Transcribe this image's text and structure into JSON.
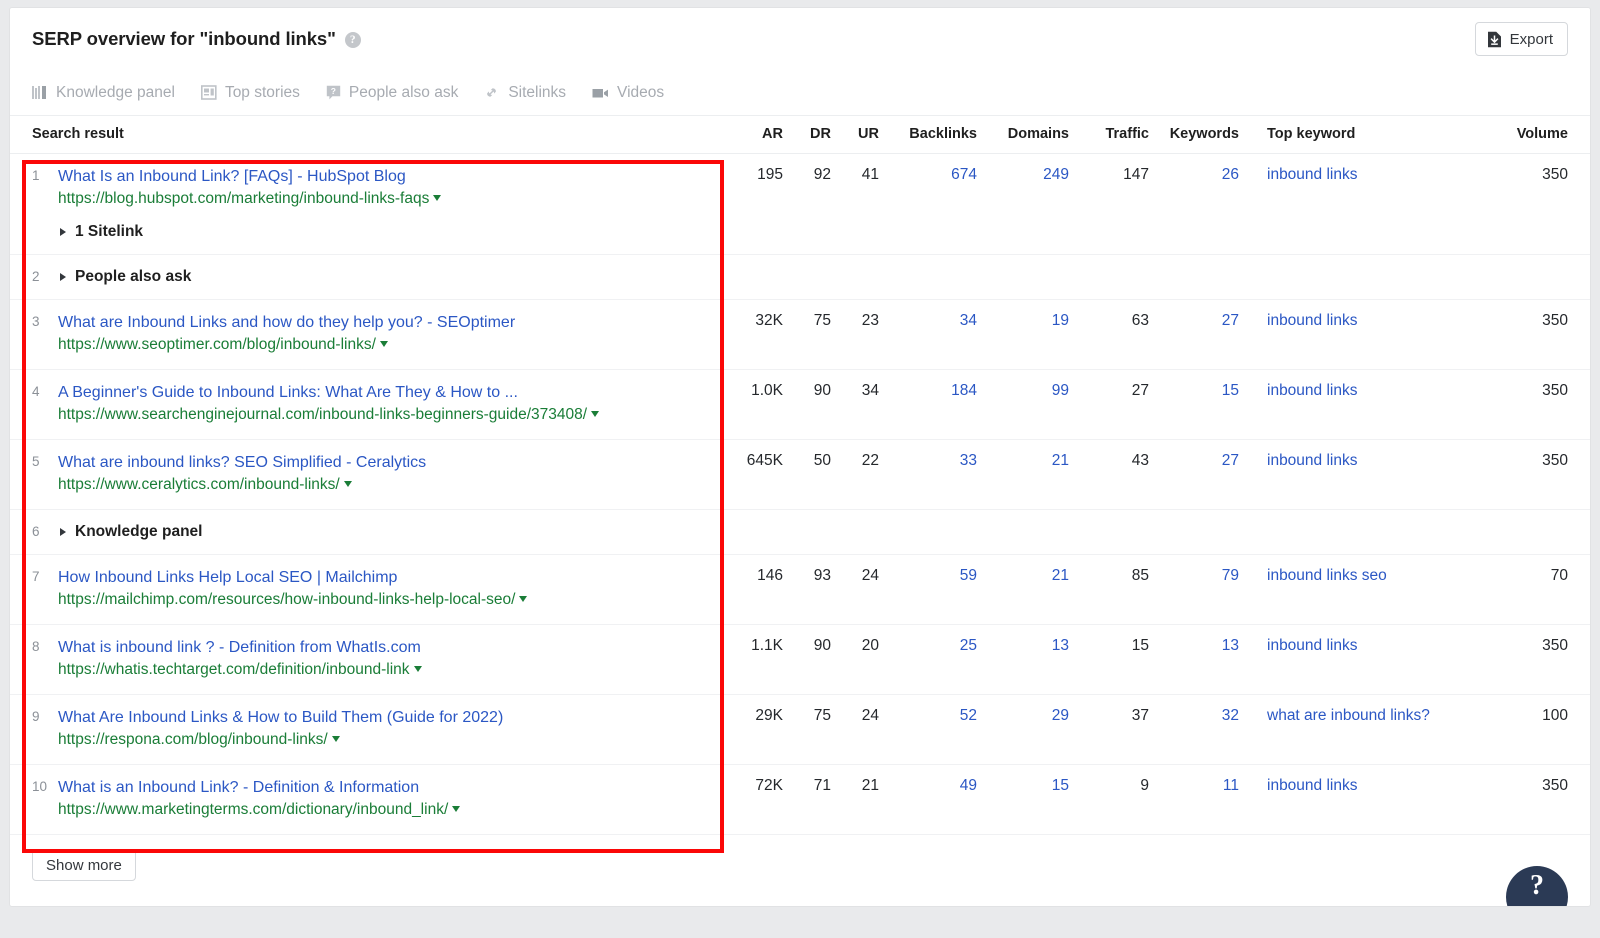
{
  "header": {
    "title": "SERP overview for \"inbound links\"",
    "help_icon": "help-circle-icon",
    "export_label": "Export",
    "export_icon": "file-download-icon"
  },
  "serp_features": [
    {
      "label": "Knowledge panel",
      "icon": "knowledge-panel-icon"
    },
    {
      "label": "Top stories",
      "icon": "top-stories-icon"
    },
    {
      "label": "People also ask",
      "icon": "people-also-ask-icon"
    },
    {
      "label": "Sitelinks",
      "icon": "sitelinks-chain-icon"
    },
    {
      "label": "Videos",
      "icon": "video-camera-icon"
    }
  ],
  "table": {
    "columns": [
      "Search result",
      "AR",
      "DR",
      "UR",
      "Backlinks",
      "Domains",
      "Traffic",
      "Keywords",
      "Top keyword",
      "Volume"
    ],
    "rows": [
      {
        "rank": "1",
        "kind": "result",
        "title": "What Is an Inbound Link? [FAQs] - HubSpot Blog",
        "url": "https://blog.hubspot.com/marketing/inbound-links-faqs",
        "sub_feature": "1 Sitelink",
        "ar": "195",
        "dr": "92",
        "ur": "41",
        "backlinks": "674",
        "domains": "249",
        "traffic": "147",
        "keywords": "26",
        "top_keyword": "inbound links",
        "volume": "350"
      },
      {
        "rank": "2",
        "kind": "feature",
        "feature_label": "People also ask",
        "ar": "",
        "dr": "",
        "ur": "",
        "backlinks": "",
        "domains": "",
        "traffic": "",
        "keywords": "",
        "top_keyword": "",
        "volume": ""
      },
      {
        "rank": "3",
        "kind": "result",
        "title": "What are Inbound Links and how do they help you? - SEOptimer",
        "url": "https://www.seoptimer.com/blog/inbound-links/",
        "sub_feature": "",
        "ar": "32K",
        "dr": "75",
        "ur": "23",
        "backlinks": "34",
        "domains": "19",
        "traffic": "63",
        "keywords": "27",
        "top_keyword": "inbound links",
        "volume": "350"
      },
      {
        "rank": "4",
        "kind": "result",
        "title": "A Beginner's Guide to Inbound Links: What Are They & How to ...",
        "url": "https://www.searchenginejournal.com/inbound-links-beginners-guide/373408/",
        "sub_feature": "",
        "ar": "1.0K",
        "dr": "90",
        "ur": "34",
        "backlinks": "184",
        "domains": "99",
        "traffic": "27",
        "keywords": "15",
        "top_keyword": "inbound links",
        "volume": "350"
      },
      {
        "rank": "5",
        "kind": "result",
        "title": "What are inbound links? SEO Simplified - Ceralytics",
        "url": "https://www.ceralytics.com/inbound-links/",
        "sub_feature": "",
        "ar": "645K",
        "dr": "50",
        "ur": "22",
        "backlinks": "33",
        "domains": "21",
        "traffic": "43",
        "keywords": "27",
        "top_keyword": "inbound links",
        "volume": "350"
      },
      {
        "rank": "6",
        "kind": "feature",
        "feature_label": "Knowledge panel",
        "ar": "",
        "dr": "",
        "ur": "",
        "backlinks": "",
        "domains": "",
        "traffic": "",
        "keywords": "",
        "top_keyword": "",
        "volume": ""
      },
      {
        "rank": "7",
        "kind": "result",
        "title": "How Inbound Links Help Local SEO | Mailchimp",
        "url": "https://mailchimp.com/resources/how-inbound-links-help-local-seo/",
        "sub_feature": "",
        "ar": "146",
        "dr": "93",
        "ur": "24",
        "backlinks": "59",
        "domains": "21",
        "traffic": "85",
        "keywords": "79",
        "top_keyword": "inbound links seo",
        "volume": "70"
      },
      {
        "rank": "8",
        "kind": "result",
        "title": "What is inbound link ? - Definition from WhatIs.com",
        "url": "https://whatis.techtarget.com/definition/inbound-link",
        "sub_feature": "",
        "ar": "1.1K",
        "dr": "90",
        "ur": "20",
        "backlinks": "25",
        "domains": "13",
        "traffic": "15",
        "keywords": "13",
        "top_keyword": "inbound links",
        "volume": "350"
      },
      {
        "rank": "9",
        "kind": "result",
        "title": "What Are Inbound Links & How to Build Them (Guide for 2022)",
        "url": "https://respona.com/blog/inbound-links/",
        "sub_feature": "",
        "ar": "29K",
        "dr": "75",
        "ur": "24",
        "backlinks": "52",
        "domains": "29",
        "traffic": "37",
        "keywords": "32",
        "top_keyword": "what are inbound links?",
        "volume": "100"
      },
      {
        "rank": "10",
        "kind": "result",
        "title": "What is an Inbound Link? - Definition & Information",
        "url": "https://www.marketingterms.com/dictionary/inbound_link/",
        "sub_feature": "",
        "ar": "72K",
        "dr": "71",
        "ur": "21",
        "backlinks": "49",
        "domains": "15",
        "traffic": "9",
        "keywords": "11",
        "top_keyword": "inbound links",
        "volume": "350"
      }
    ]
  },
  "footer": {
    "show_more_label": "Show more"
  },
  "fab": {
    "icon": "help-question-icon",
    "glyph": "?"
  },
  "colors": {
    "link_blue": "#2b57c4",
    "url_green": "#1a7d37",
    "annotation_red": "#fb0707",
    "muted_grey": "#a7abb1",
    "fab_navy": "#2b3a55"
  }
}
